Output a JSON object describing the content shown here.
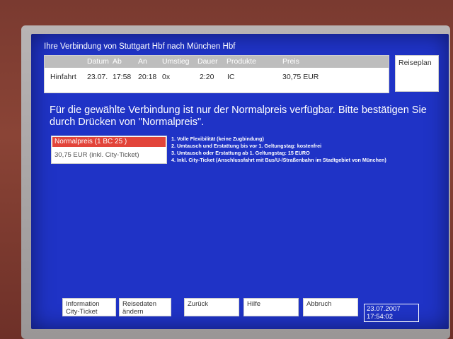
{
  "title": "Ihre Verbindung von Stuttgart Hbf nach München Hbf",
  "connection": {
    "headers": {
      "datum": "Datum",
      "ab": "Ab",
      "an": "An",
      "umstieg": "Umstieg",
      "dauer": "Dauer",
      "produkte": "Produkte",
      "preis": "Preis"
    },
    "row": {
      "label": "Hinfahrt",
      "datum": "23.07.",
      "ab": "17:58",
      "an": "20:18",
      "umstieg": "0x",
      "dauer": "2:20",
      "produkte": "IC",
      "preis": "30,75 EUR"
    }
  },
  "reiseplan_label": "Reiseplan",
  "message": "Für die gewählte Verbindung ist nur der Normalpreis verfügbar. Bitte bestätigen Sie durch Drücken von \"Normalpreis\".",
  "option": {
    "selected_label": "Normalpreis (1 BC 25 )",
    "price": "30,75 EUR (inkl. City-Ticket)"
  },
  "features": [
    "1. Volle Flexibilität (keine Zugbindung)",
    "2. Umtausch und Erstattung bis vor 1. Geltungstag:  kostenfrei",
    "3. Umtausch oder Erstattung ab 1. Geltungstag:     15 EURO",
    "4. Inkl. City-Ticket (Anschlussfahrt mit Bus/U-/Straßenbahn im Stadtgebiet von München)"
  ],
  "softkeys": {
    "info_line1": "Information",
    "info_line2": "City-Ticket",
    "reisedaten_line1": "Reisedaten",
    "reisedaten_line2": "ändern",
    "zurueck": "Zurück",
    "hilfe": "Hilfe",
    "abbruch": "Abbruch"
  },
  "datetime": {
    "date": "23.07.2007",
    "time": "17:54:02"
  }
}
